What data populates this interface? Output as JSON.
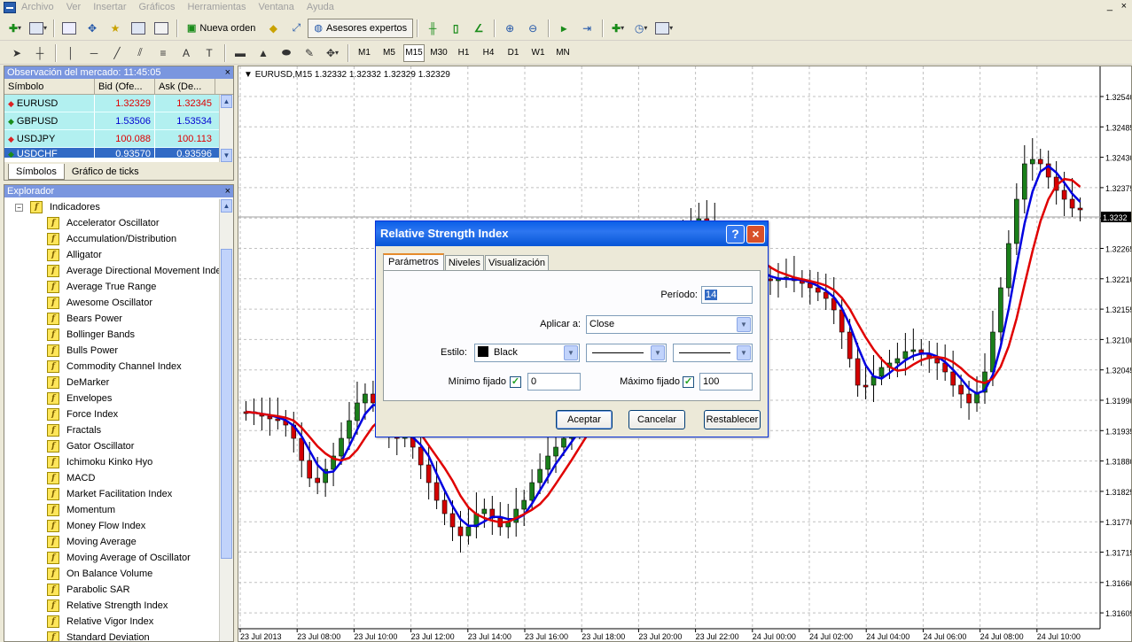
{
  "menu": {
    "items": [
      "Archivo",
      "Ver",
      "Insertar",
      "Gráficos",
      "Herramientas",
      "Ventana",
      "Ayuda"
    ],
    "window_minimize": "_",
    "window_close": "×"
  },
  "toolbar": {
    "new_order_label": "Nueva orden",
    "experts_label": "Asesores expertos",
    "timeframes": [
      "M1",
      "M5",
      "M15",
      "M30",
      "H1",
      "H4",
      "D1",
      "W1",
      "MN"
    ],
    "active_timeframe": "M15"
  },
  "market_watch": {
    "title": "Observación del mercado: 11:45:05",
    "close": "×",
    "columns": [
      "Símbolo",
      "Bid (Ofe...",
      "Ask (De..."
    ],
    "rows": [
      {
        "symbol": "EURUSD",
        "bid": "1.32329",
        "ask": "1.32345",
        "direction": "down"
      },
      {
        "symbol": "GBPUSD",
        "bid": "1.53506",
        "ask": "1.53534",
        "direction": "up"
      },
      {
        "symbol": "USDJPY",
        "bid": "100.088",
        "ask": "100.113",
        "direction": "down"
      },
      {
        "symbol": "USDCHF",
        "bid": "0.93570",
        "ask": "0.93596",
        "direction": "up"
      }
    ],
    "tabs": [
      "Símbolos",
      "Gráfico de ticks"
    ]
  },
  "navigator": {
    "title": "Explorador",
    "close": "×",
    "root_label": "Indicadores",
    "items": [
      "Accelerator Oscillator",
      "Accumulation/Distribution",
      "Alligator",
      "Average Directional Movement Inde",
      "Average True Range",
      "Awesome Oscillator",
      "Bears Power",
      "Bollinger Bands",
      "Bulls Power",
      "Commodity Channel Index",
      "DeMarker",
      "Envelopes",
      "Force Index",
      "Fractals",
      "Gator Oscillator",
      "Ichimoku Kinko Hyo",
      "MACD",
      "Market Facilitation Index",
      "Momentum",
      "Money Flow Index",
      "Moving Average",
      "Moving Average of Oscillator",
      "On Balance Volume",
      "Parabolic SAR",
      "Relative Strength Index",
      "Relative Vigor Index",
      "Standard Deviation"
    ]
  },
  "chart": {
    "title": "EURUSD,M15  1.32332 1.32332 1.32329 1.32329",
    "current_price_label": "1.3232",
    "price_labels": [
      "1.32540",
      "1.32485",
      "1.32430",
      "1.32375",
      "1.32320",
      "1.32265",
      "1.32210",
      "1.32155",
      "1.32100",
      "1.32045",
      "1.31990",
      "1.31935",
      "1.31880",
      "1.31825",
      "1.31770",
      "1.31715",
      "1.31660",
      "1.31605"
    ],
    "time_labels": [
      "23 Jul 2013",
      "23 Jul 08:00",
      "23 Jul 10:00",
      "23 Jul 12:00",
      "23 Jul 14:00",
      "23 Jul 16:00",
      "23 Jul 18:00",
      "23 Jul 20:00",
      "23 Jul 22:00",
      "24 Jul 00:00",
      "24 Jul 02:00",
      "24 Jul 04:00",
      "24 Jul 06:00",
      "24 Jul 08:00",
      "24 Jul 10:00"
    ],
    "colors": {
      "bull": "#1a7f1a",
      "bear": "#d40000",
      "ma_fast": "#0000e0",
      "ma_slow": "#e00000",
      "grid": "#c0c0c0"
    }
  },
  "dialog": {
    "title": "Relative Strength Index",
    "help": "?",
    "close": "×",
    "tabs": [
      "Parámetros",
      "Niveles",
      "Visualización"
    ],
    "period_label": "Período:",
    "period_value": "14",
    "apply_label": "Aplicar a:",
    "apply_value": "Close",
    "style_label": "Estilo:",
    "style_color": "Black",
    "min_label": "Mínimo fijado",
    "min_value": "0",
    "max_label": "Máximo fijado",
    "max_value": "100",
    "checkmark": "✓",
    "ok_label": "Aceptar",
    "cancel_label": "Cancelar",
    "reset_label": "Restablecer"
  }
}
